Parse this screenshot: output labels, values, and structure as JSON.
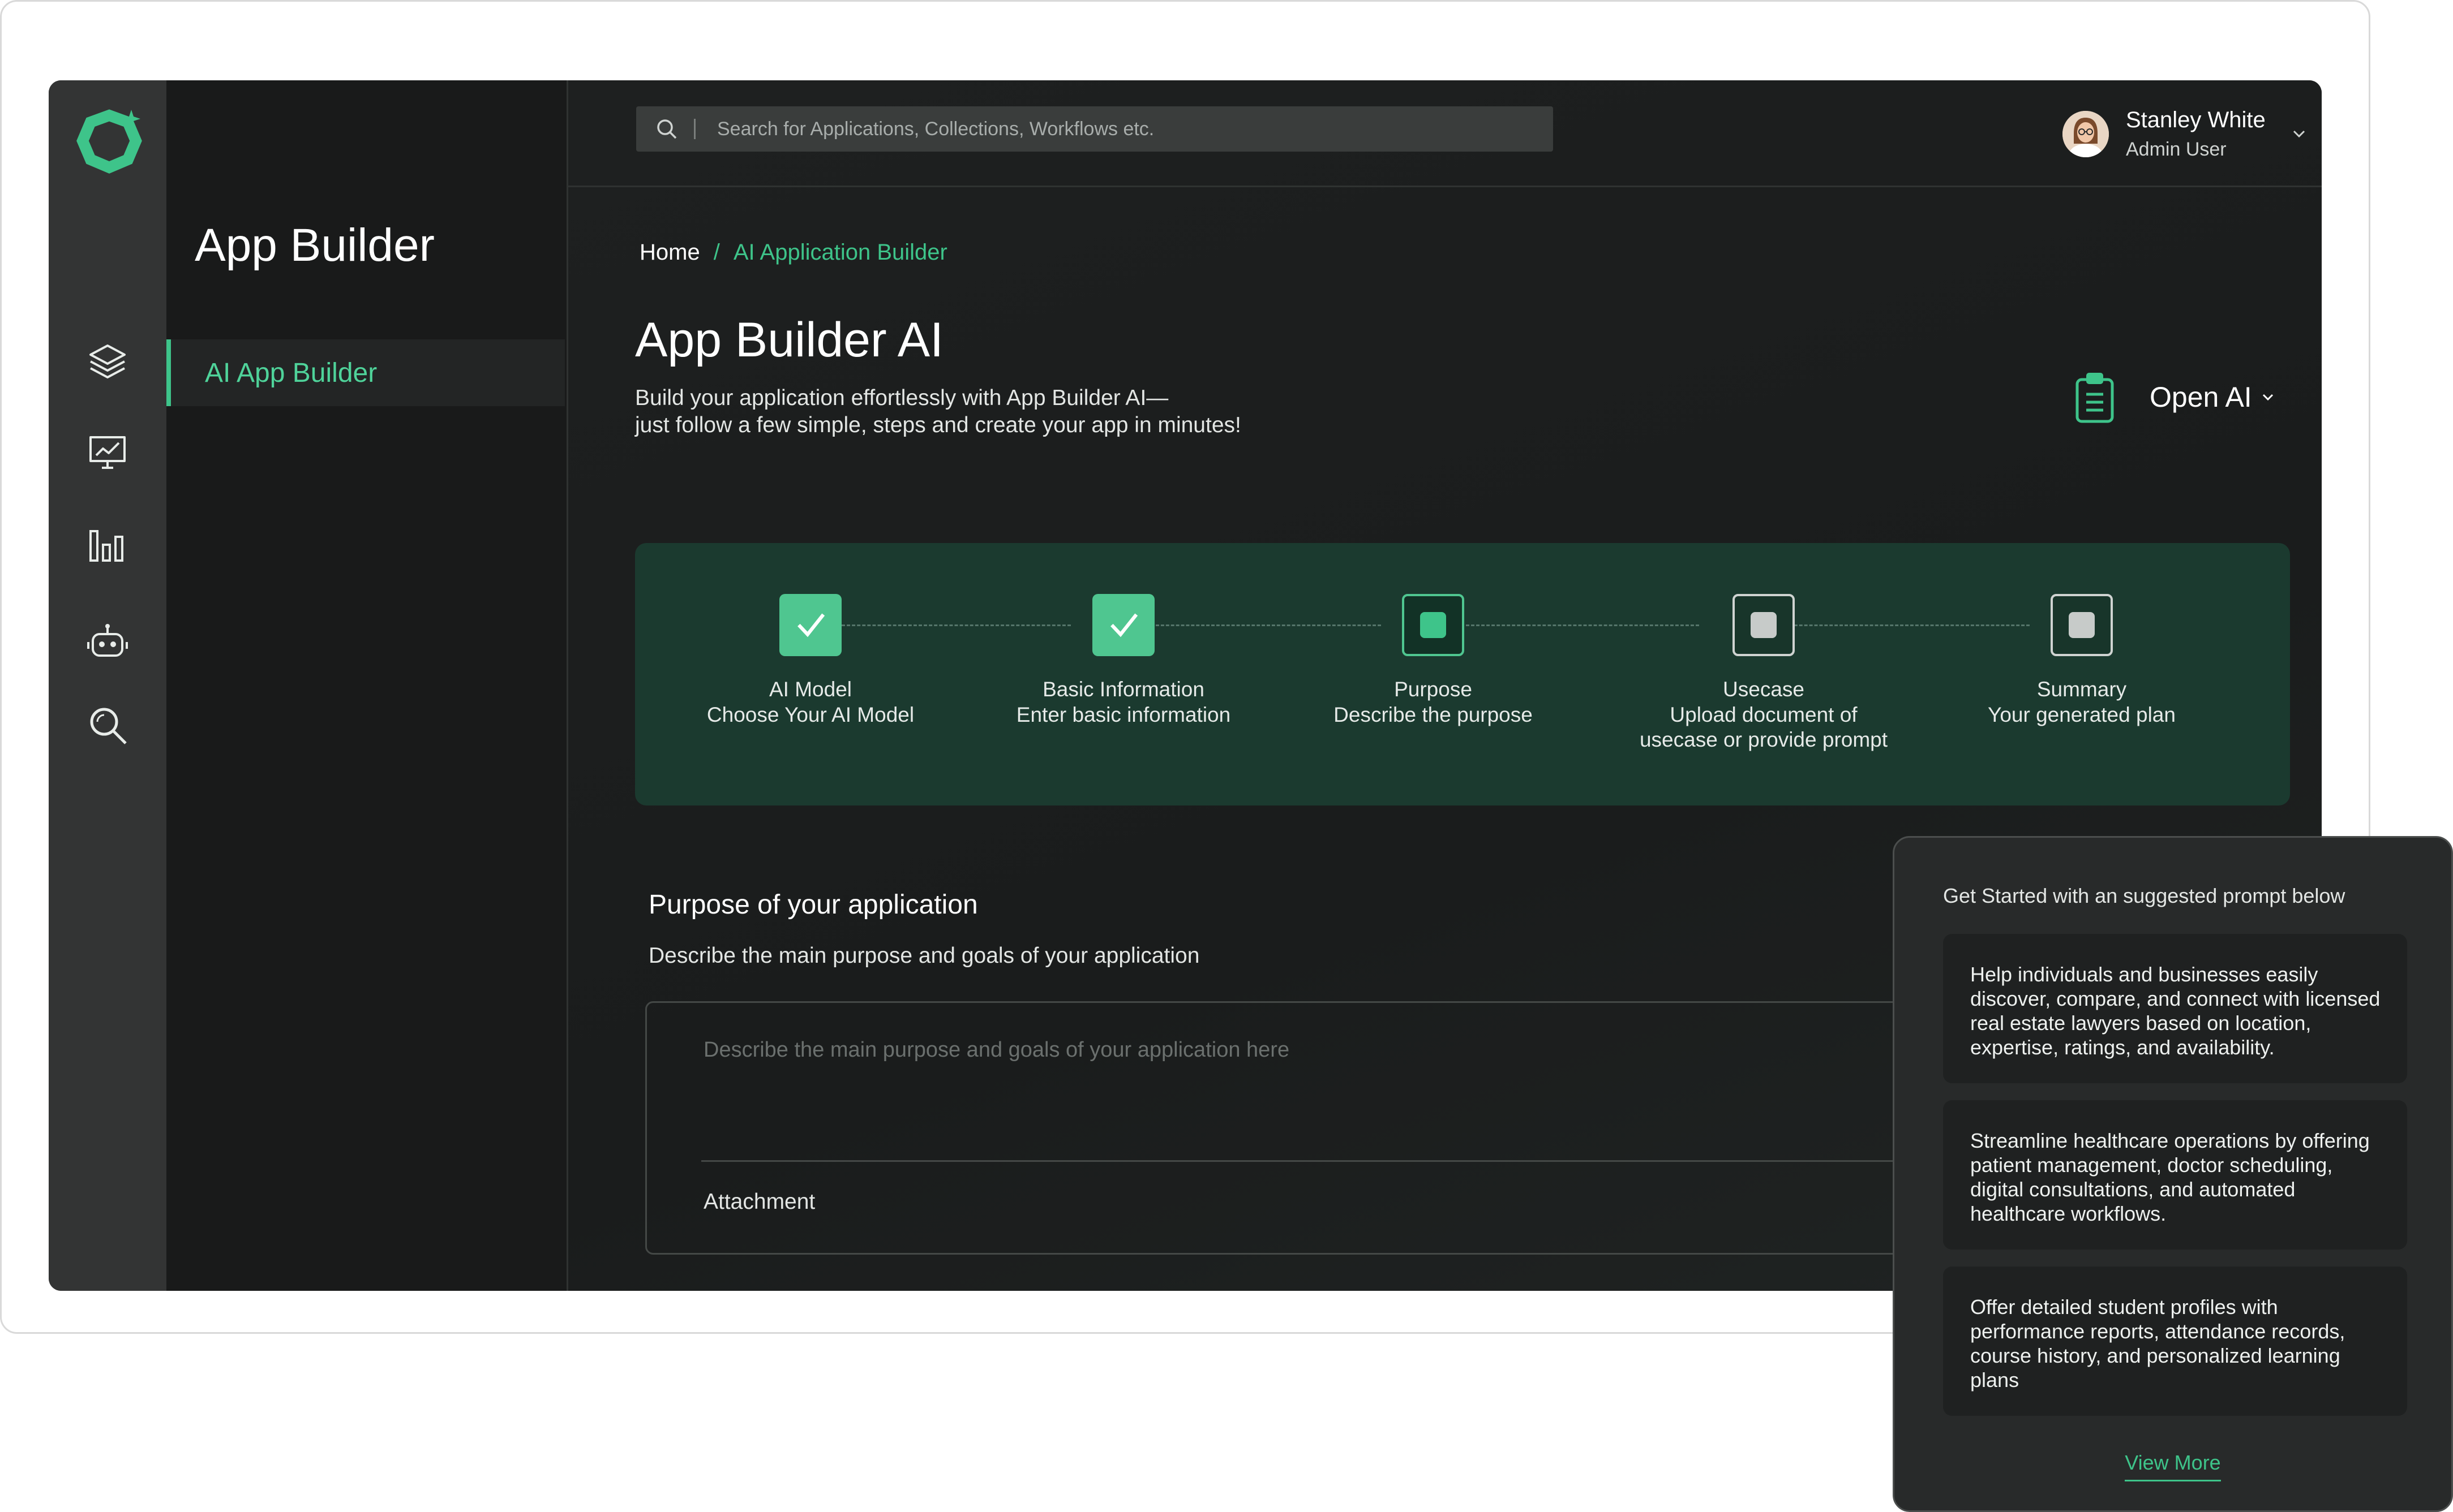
{
  "app": {
    "section_title": "App Builder"
  },
  "rail": {
    "items": [
      {
        "icon": "layers-icon"
      },
      {
        "icon": "monitor-chart-icon"
      },
      {
        "icon": "bar-chart-icon"
      },
      {
        "icon": "robot-icon"
      },
      {
        "icon": "search-icon"
      }
    ]
  },
  "sidebar": {
    "items": [
      {
        "label": "AI App Builder",
        "active": true
      }
    ]
  },
  "search": {
    "placeholder": "Search for Applications, Collections, Workflows etc.",
    "value": ""
  },
  "user": {
    "name": "Stanley White",
    "role": "Admin User"
  },
  "breadcrumb": {
    "home": "Home",
    "separator": "/",
    "current": "AI Application Builder"
  },
  "page": {
    "title": "App Builder AI",
    "description_line1": "Build your application effortlessly with App Builder AI—",
    "description_line2": "just follow a few simple, steps and create your app in minutes!"
  },
  "model": {
    "selected": "Open AI"
  },
  "steps": [
    {
      "title": "AI Model",
      "subtitle": "Choose Your AI Model",
      "status": "done"
    },
    {
      "title": "Basic Information",
      "subtitle": "Enter basic information",
      "status": "done"
    },
    {
      "title": "Purpose",
      "subtitle": "Describe the purpose",
      "status": "active"
    },
    {
      "title": "Usecase",
      "subtitle_line1": "Upload document of",
      "subtitle_line2": "usecase or provide prompt",
      "status": "pending"
    },
    {
      "title": "Summary",
      "subtitle": "Your generated plan",
      "status": "pending"
    }
  ],
  "purpose": {
    "title": "Purpose of your application",
    "description": "Describe the main purpose and goals of your application",
    "placeholder": "Describe the main purpose and goals of your application here",
    "value": "",
    "attachment_label": "Attachment"
  },
  "suggestions": {
    "heading": "Get Started with an suggested prompt below",
    "prompts": [
      "Help individuals and businesses easily discover, compare, and connect with licensed real estate lawyers based on location, expertise, ratings, and availability.",
      "Streamline healthcare operations by offering patient management, doctor scheduling, digital consultations, and automated healthcare workflows.",
      "Offer detailed student profiles with performance reports, attendance records, course history, and personalized learning plans"
    ],
    "view_more": "View More"
  },
  "colors": {
    "accent": "#3ec48a",
    "background": "#1c1d1d",
    "rail": "#333434",
    "stepper_bg": "#1b3a2f"
  }
}
